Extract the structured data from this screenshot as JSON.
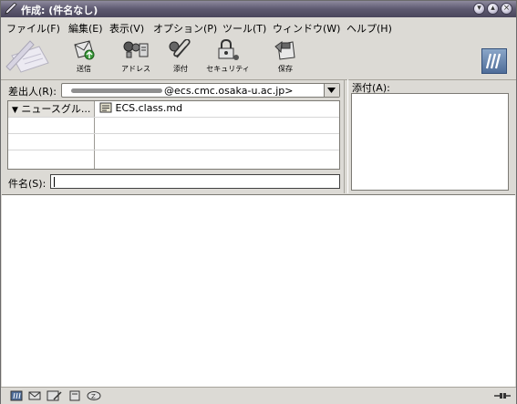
{
  "window": {
    "title": "作成: (件名なし)",
    "buttons": [
      "minimize",
      "maximize",
      "close"
    ]
  },
  "menubar": {
    "items": [
      {
        "label": "ファイル(F)"
      },
      {
        "label": "編集(E)"
      },
      {
        "label": "表示(V)"
      },
      {
        "label": "オプション(P)"
      },
      {
        "label": "ツール(T)"
      },
      {
        "label": "ウィンドウ(W)"
      },
      {
        "label": "ヘルプ(H)"
      }
    ]
  },
  "toolbar": {
    "send_label": "送信",
    "address_label": "アドレス",
    "attach_label": "添付",
    "security_label": "セキュリティ",
    "save_label": "保存"
  },
  "compose": {
    "from_label": "差出人(R):",
    "from_value": "@ecs.cmc.osaka-u.ac.jp>",
    "recipient_type": "ニュースグル...",
    "recipient_value": "ECS.class.md",
    "subject_label": "件名(S):",
    "subject_value": "",
    "attachments_label": "添付(A):"
  },
  "colors": {
    "titlebar": "#5d5970",
    "background": "#dcdad5",
    "logo": "#4f6d99"
  }
}
